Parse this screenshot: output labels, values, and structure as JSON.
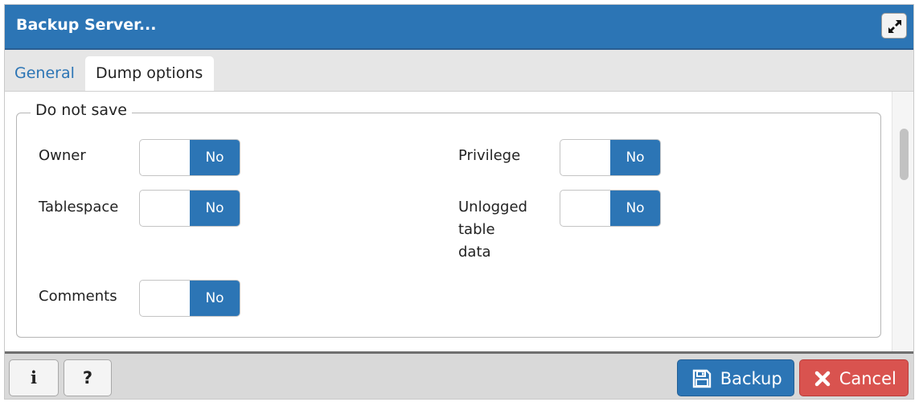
{
  "dialog": {
    "title": "Backup Server..."
  },
  "tabs": [
    {
      "label": "General"
    },
    {
      "label": "Dump options"
    }
  ],
  "section": {
    "legend": "Do not save",
    "options": [
      {
        "label": "Owner",
        "value": "No"
      },
      {
        "label": "Tablespace",
        "value": "No"
      },
      {
        "label": "Comments",
        "value": "No"
      },
      {
        "label": "Privilege",
        "value": "No"
      },
      {
        "label_lines": [
          "Unlogged",
          "table",
          "data"
        ],
        "value": "No"
      }
    ]
  },
  "footer": {
    "info_label": "i",
    "help_label": "?",
    "backup_label": "Backup",
    "cancel_label": "Cancel"
  },
  "icons": {
    "maximize": "expand-icon",
    "backup": "floppy-disk-icon",
    "cancel": "close-icon"
  },
  "colors": {
    "accent": "#2c75b5",
    "danger": "#d9534f"
  }
}
